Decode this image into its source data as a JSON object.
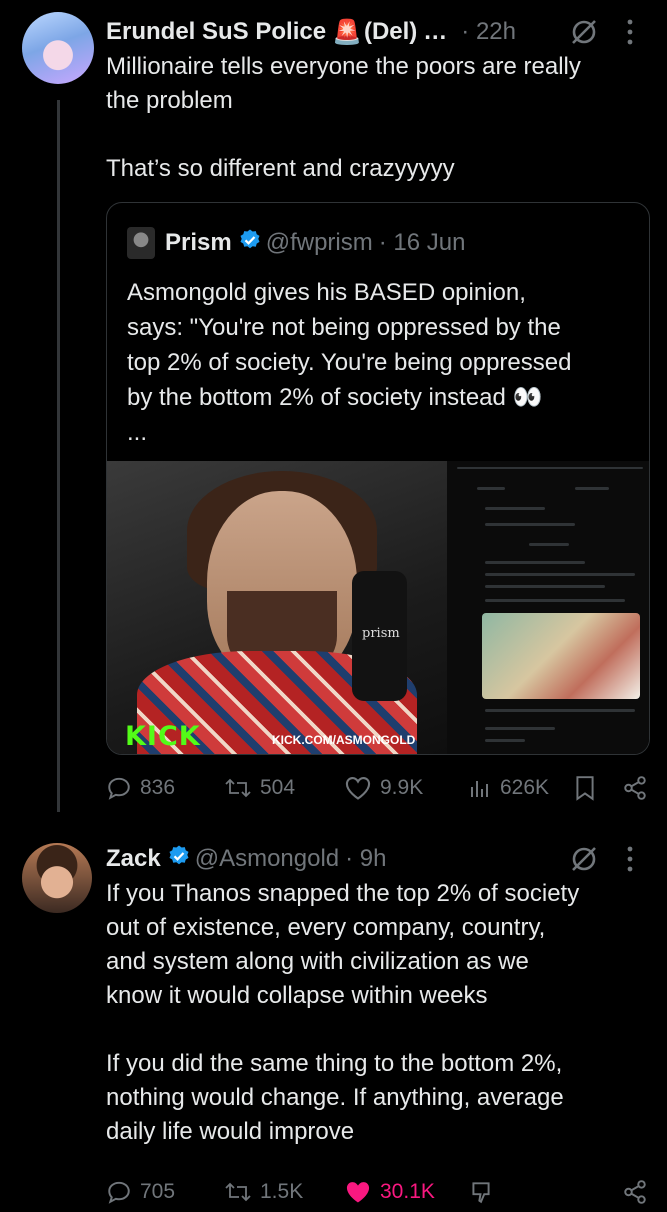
{
  "post1": {
    "display_name": "Erundel SuS Police",
    "name_emoji": "🚨",
    "name_suffix": "(Del)",
    "ellipsis": "…",
    "time": "· 22h",
    "text": "Millionaire tells everyone the poors are really\nthe problem\n\nThat’s so different and crazyyyyy",
    "quote": {
      "display_name": "Prism",
      "handle": "@fwprism",
      "date": "· 16 Jun",
      "text": "Asmongold gives his BASED opinion,\nsays: \"You're not being oppressed by the\ntop 2% of society. You're being oppressed\nby the bottom 2% of society instead 👀\n...",
      "media": {
        "kick_logo": "KICK",
        "kick_url": "KICK.COM/ASMONGOLD",
        "watermark": "prism"
      }
    },
    "actions": {
      "replies": "836",
      "reposts": "504",
      "likes": "9.9K",
      "views": "626K"
    }
  },
  "post2": {
    "display_name": "Zack",
    "handle": "@Asmongold",
    "time": "· 9h",
    "text": "If you Thanos snapped the top 2% of society\nout of existence, every company, country,\nand system along with civilization as we\nknow it would collapse within weeks\n\nIf you did the same thing to the bottom 2%,\nnothing would change. If anything, average\ndaily life would improve",
    "actions": {
      "replies": "705",
      "reposts": "1.5K",
      "likes": "30.1K"
    }
  },
  "colors": {
    "background": "#000000",
    "text": "#e7e9ea",
    "muted": "#71767b",
    "verified": "#1d9bf0",
    "like": "#f91880",
    "kick_green": "#53fc18"
  }
}
